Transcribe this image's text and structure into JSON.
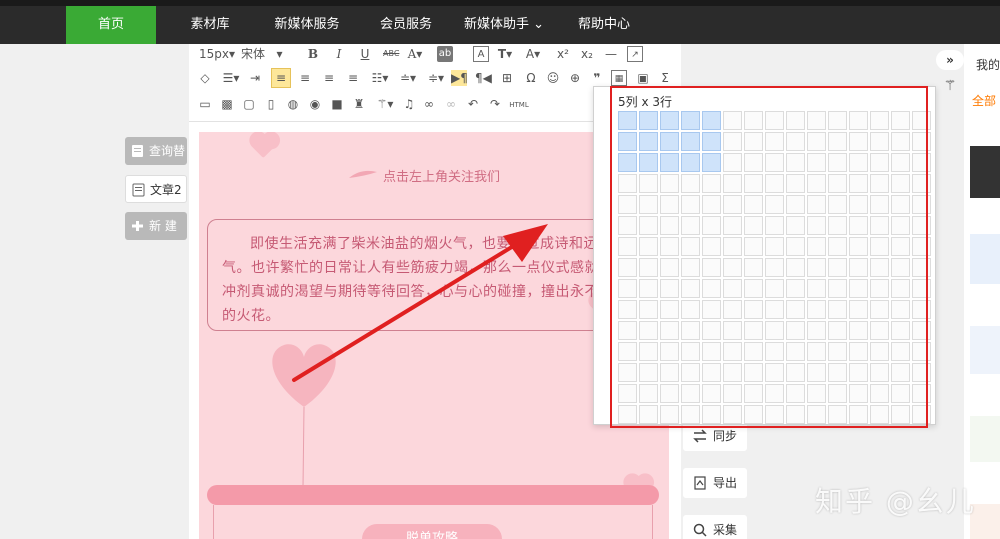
{
  "nav": {
    "items": [
      {
        "label": "首页",
        "active": true
      },
      {
        "label": "素材库"
      },
      {
        "label": "新媒体服务"
      },
      {
        "label": "会员服务"
      },
      {
        "label": "新媒体助手 ⌄"
      },
      {
        "label": "帮助中心"
      }
    ]
  },
  "toolbar": {
    "font_size": "15px",
    "font_name": "宋体",
    "icons": [
      "bold-icon",
      "italic-icon",
      "underline-icon",
      "strikethrough-icon",
      "font-color-icon",
      "background-color-icon",
      "border-icon",
      "text-size-icon",
      "letter-spacing-icon",
      "superscript-icon",
      "subscript-icon",
      "horizontal-rule-icon",
      "export-icon",
      "eraser-icon",
      "indent-icon",
      "outdent-icon",
      "align-left-icon",
      "align-center-icon",
      "align-right-icon",
      "justify-icon",
      "line-height-icon",
      "paragraph-spacing-icon",
      "ltr-icon",
      "rtl-icon",
      "clear-format-icon",
      "special-char-icon",
      "emoji-icon",
      "search-icon",
      "quote-icon",
      "table-icon",
      "image-icon",
      "sigma-icon",
      "insert-image-icon",
      "image-gallery-icon",
      "picture-icon",
      "palette-icon",
      "location-icon",
      "video-icon",
      "stamp-icon",
      "wand-icon",
      "music-icon",
      "link-icon",
      "unlink-icon",
      "undo-icon",
      "redo-icon",
      "html-icon"
    ],
    "html_label": "HTML"
  },
  "left": {
    "query_label": "查询替",
    "doc_label": "文章2",
    "new_label": "新 建"
  },
  "document": {
    "follow_text": "点击左上角关注我们",
    "paragraph": "即使生活充满了柴米油盐的烟火气，也要有过成诗和远方的勇气。也许繁忙的日常让人有些筋疲力竭，那么一点仪式感就是的缓冲剂真诚的渴望与期待等待回答，心与心的碰撞，撞出永不熄的爱的火花。",
    "pill_label": "脱单攻略"
  },
  "popup": {
    "size_label": "5列 x 3行",
    "cols": 15,
    "rows": 15,
    "selected_cols": 5,
    "selected_rows": 3
  },
  "side": {
    "sync_label": "同步",
    "export_label": "导出",
    "collect_label": "采集"
  },
  "right_panel": {
    "my_label": "我的",
    "all_label": "全部"
  },
  "watermark": "知乎 @幺儿",
  "colors": {
    "nav_bg": "#2b2b2b",
    "nav_active": "#3aaa35",
    "doc_bg": "#fcd7dc",
    "accent_pink": "#f49aa9",
    "annotation_red": "#e02020",
    "cell_selected": "#cfe3fa",
    "all_label_color": "#ff7a00"
  }
}
